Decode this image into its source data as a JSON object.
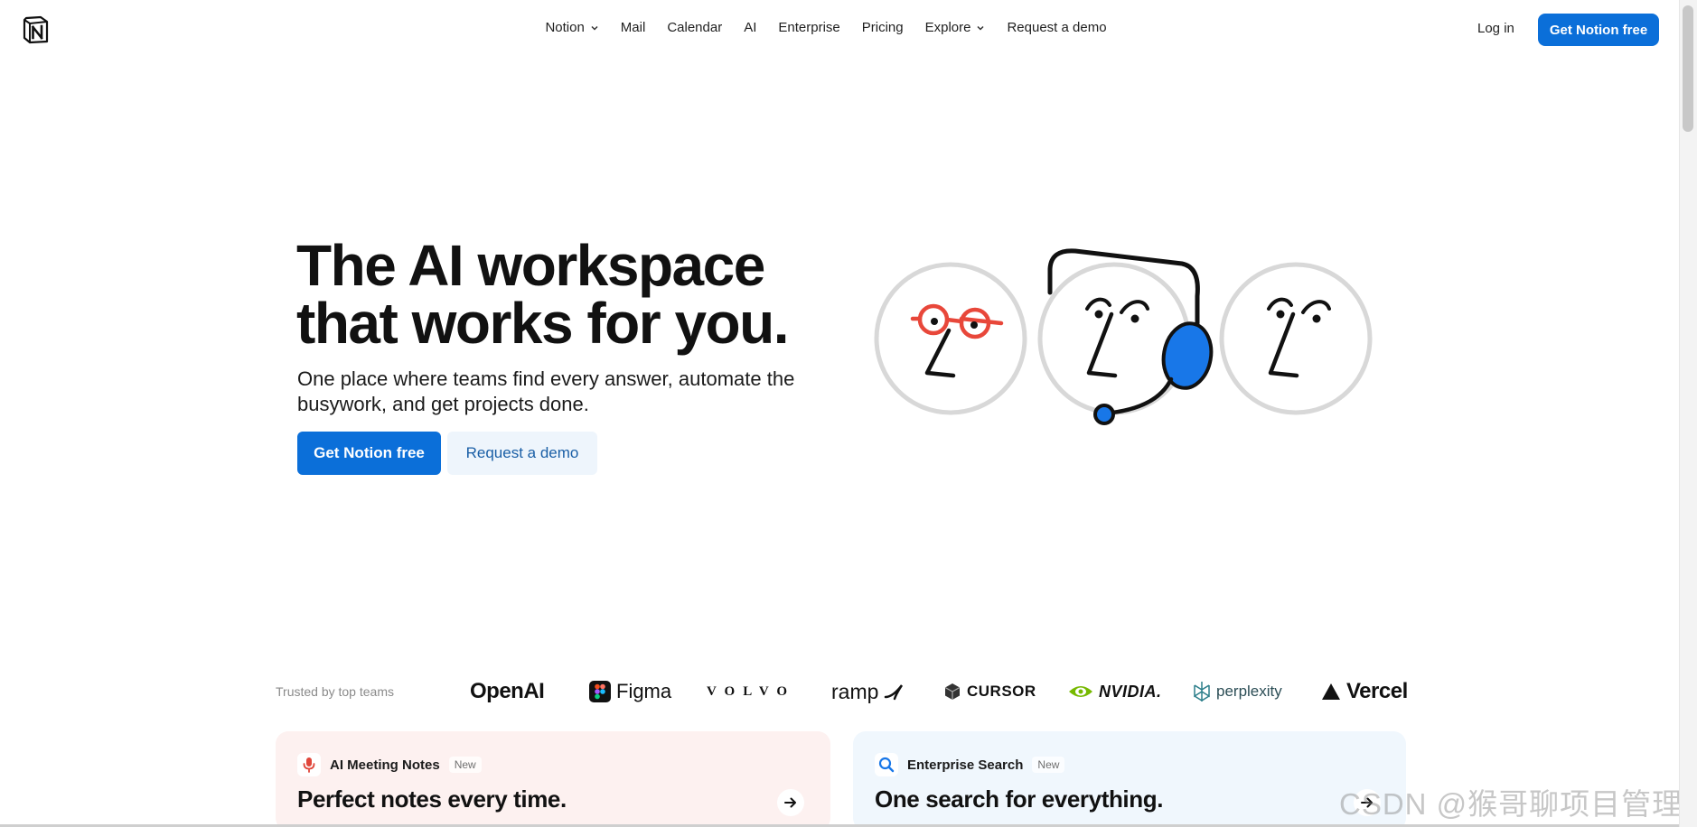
{
  "nav": {
    "items": [
      {
        "label": "Notion",
        "dropdown": true
      },
      {
        "label": "Mail",
        "dropdown": false
      },
      {
        "label": "Calendar",
        "dropdown": false
      },
      {
        "label": "AI",
        "dropdown": false
      },
      {
        "label": "Enterprise",
        "dropdown": false
      },
      {
        "label": "Pricing",
        "dropdown": false
      },
      {
        "label": "Explore",
        "dropdown": true
      },
      {
        "label": "Request a demo",
        "dropdown": false
      }
    ],
    "login": "Log in",
    "cta": "Get Notion free"
  },
  "hero": {
    "title_line1": "The AI workspace",
    "title_line2": "that works for you.",
    "subtitle": "One place where teams find every answer, automate the busywork, and get projects done.",
    "primary_cta": "Get Notion free",
    "secondary_cta": "Request a demo"
  },
  "trusted": {
    "label": "Trusted by top teams",
    "brands": [
      "OpenAI",
      "Figma",
      "VOLVO",
      "ramp",
      "CURSOR",
      "NVIDIA.",
      "perplexity",
      "Vercel"
    ]
  },
  "cards": [
    {
      "label": "AI Meeting Notes",
      "badge": "New",
      "title": "Perfect notes every time.",
      "icon": "microphone-icon"
    },
    {
      "label": "Enterprise Search",
      "badge": "New",
      "title": "One search for everything.",
      "icon": "search-icon"
    }
  ],
  "watermark": "CSDN @猴哥聊项目管理",
  "colors": {
    "primary": "#0b6fd9",
    "secondary_bg": "#eef5fc",
    "card_notes_bg": "#fdf1f0",
    "card_search_bg": "#f0f7fd",
    "glasses": "#e8473a",
    "headset": "#1877e8"
  }
}
